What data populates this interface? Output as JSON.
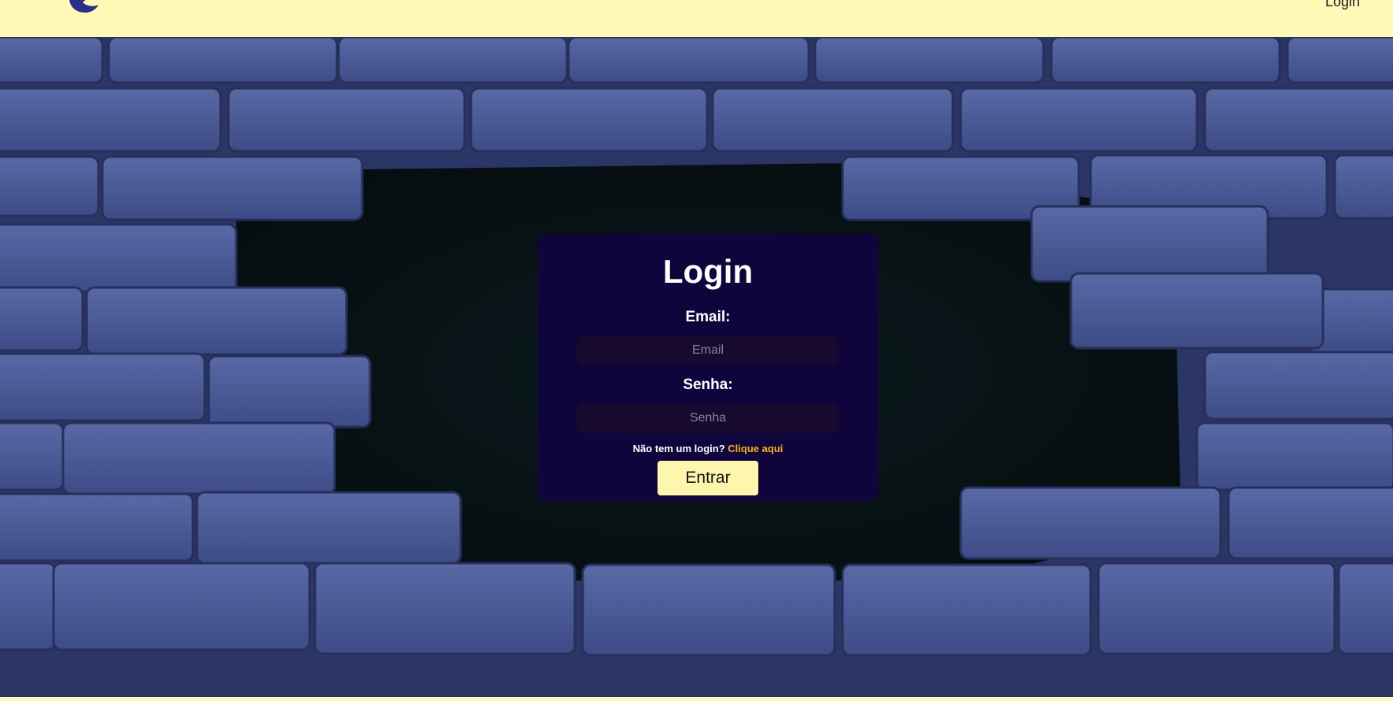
{
  "header": {
    "logo_icon": "crescent-logo-icon",
    "nav_login_label": "Login"
  },
  "login_card": {
    "title": "Login",
    "email_label": "Email:",
    "email_placeholder": "Email",
    "email_value": "",
    "password_label": "Senha:",
    "password_placeholder": "Senha",
    "password_value": "",
    "signup_prompt": "Não tem um login?",
    "signup_link": "Clique aqui",
    "submit_label": "Entrar"
  },
  "colors": {
    "header_bg": "#fff9b8",
    "card_bg": "#100440",
    "link_accent": "#f6b31a",
    "button_bg": "#fff6ad",
    "brick": "#4a5a9a"
  }
}
